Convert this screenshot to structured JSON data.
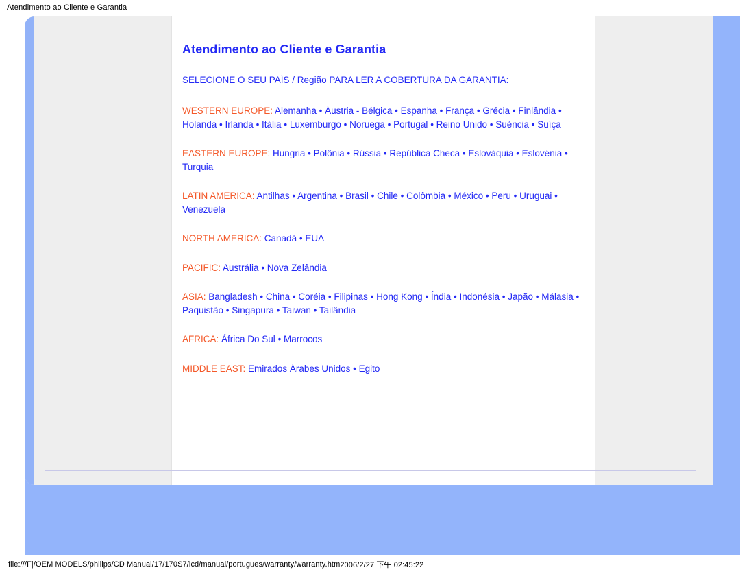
{
  "window": {
    "title": "Atendimento ao Cliente e Garantia"
  },
  "status_bar": {
    "url": "file:///F|/OEM MODELS/philips/CD Manual/17/170S7/lcd/manual/portugues/warranty/warranty.htm",
    "timestamp": "2006/2/27 下午 02:45:22"
  },
  "colors": {
    "title_blue": "#2329f5",
    "link_blue": "#2329f5",
    "region_orange": "#f4592a",
    "page_blue": "#93b4fb",
    "panel_gray": "#eeeeee",
    "rule_gray": "#9a9a9a"
  },
  "article": {
    "title": "Atendimento ao Cliente e Garantia",
    "select_line": "SELECIONE O SEU PAÍS / Região PARA LER A COBERTURA DA GARANTIA:",
    "separator": " • ",
    "regions": [
      {
        "label": "WESTERN EUROPE:",
        "countries": [
          "Alemanha",
          "Áustria - Bélgica",
          "Espanha",
          "França",
          "Grécia",
          "Finlândia",
          "Holanda",
          "Irlanda",
          "Itália",
          "Luxemburgo",
          "Noruega",
          "Portugal",
          "Reino Unido",
          "Suéncia",
          "Suíça"
        ]
      },
      {
        "label": "EASTERN EUROPE:",
        "countries": [
          "Hungria",
          "Polônia",
          "Rússia",
          "República Checa",
          "Eslováquia",
          "Eslovénia",
          "Turquia"
        ]
      },
      {
        "label": "LATIN AMERICA:",
        "countries": [
          "Antilhas",
          "Argentina",
          "Brasil",
          "Chile",
          "Colômbia",
          "México",
          "Peru",
          "Uruguai",
          "Venezuela"
        ]
      },
      {
        "label": "NORTH AMERICA:",
        "countries": [
          "Canadá",
          "EUA"
        ]
      },
      {
        "label": "PACIFIC:",
        "countries": [
          "Austrália",
          "Nova Zelândia"
        ]
      },
      {
        "label": "ASIA:",
        "countries": [
          "Bangladesh",
          "China",
          "Coréia",
          "Filipinas",
          "Hong Kong",
          "Índia",
          "Indonésia",
          "Japão",
          "Málasia",
          "Paquistão",
          "Singapura",
          "Taiwan",
          "Tailândia"
        ]
      },
      {
        "label": "AFRICA:",
        "countries": [
          "África Do Sul",
          "Marrocos"
        ]
      },
      {
        "label": "MIDDLE EAST:",
        "countries": [
          "Emirados Árabes Unidos",
          "Egito"
        ]
      }
    ]
  }
}
